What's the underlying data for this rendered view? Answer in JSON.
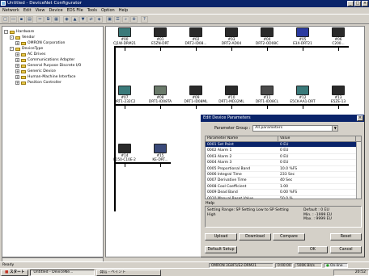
{
  "window": {
    "title": "Untitled - DeviceNet Configurator"
  },
  "menu": [
    "Network",
    "Edit",
    "View",
    "Device",
    "EDS File",
    "Tools",
    "Option",
    "Help"
  ],
  "toolbar_icons": [
    "new-icon",
    "open-icon",
    "save-icon",
    "print-icon",
    "cut-icon",
    "copy-icon",
    "paste-icon",
    "online-icon",
    "upload-icon",
    "download-icon",
    "compare-icon",
    "monitor-icon",
    "parameter-icon",
    "properties-icon",
    "find-icon",
    "zoom-icon",
    "help-icon"
  ],
  "tree": [
    {
      "label": "Hardware",
      "level": 0,
      "exp": "-"
    },
    {
      "label": "Vendor",
      "level": 1,
      "exp": "-"
    },
    {
      "label": "OMRON Corporation",
      "level": 2,
      "exp": "+"
    },
    {
      "label": "DeviceType",
      "level": 1,
      "exp": "-"
    },
    {
      "label": "AC Drives",
      "level": 2,
      "exp": "+"
    },
    {
      "label": "Communications Adapter",
      "level": 2,
      "exp": "+"
    },
    {
      "label": "General Purpose Discrete I/O",
      "level": 2,
      "exp": "+"
    },
    {
      "label": "Generic Device",
      "level": 2,
      "exp": "+"
    },
    {
      "label": "Human-Machine Interface",
      "level": 2,
      "exp": "+"
    },
    {
      "label": "Position Controller",
      "level": 2,
      "exp": "+"
    }
  ],
  "devices": {
    "row1": [
      {
        "addr": "#00",
        "name": "CJ1W-DRM21",
        "color": "#3a7a7a"
      },
      {
        "addr": "#01",
        "name": "E5ZN-DRT",
        "color": "#2a2a2a"
      },
      {
        "addr": "#02",
        "name": "DRT2-ID08...",
        "color": "#2a2a2a"
      },
      {
        "addr": "#03",
        "name": "DRT2-AD04",
        "color": "#2a2a2a"
      },
      {
        "addr": "#04",
        "name": "DRT2-OD08C",
        "color": "#2a2a2a"
      },
      {
        "addr": "#05",
        "name": "E3X-DRT21",
        "color": "#2a3aa0"
      },
      {
        "addr": "#06",
        "name": "C200...",
        "color": "#2a2a2a"
      }
    ],
    "row2": [
      {
        "addr": "#07",
        "name": "DRT1-232C2",
        "color": "#3a7a7a"
      },
      {
        "addr": "#08",
        "name": "DRT1-ID08TA",
        "color": "#6a7a6a"
      },
      {
        "addr": "#09",
        "name": "DRT1-ID08ML",
        "color": "#2a2a2a"
      },
      {
        "addr": "#10",
        "name": "DRT1-MD32ML",
        "color": "#2a2a2a"
      },
      {
        "addr": "#11",
        "name": "DRT1-ID08CL",
        "color": "#4a4a4a"
      },
      {
        "addr": "#12",
        "name": "E5CK-AA1-DRT",
        "color": "#3a7a7a"
      },
      {
        "addr": "#13",
        "name": "E5ZE-13",
        "color": "#2a2a2a"
      }
    ],
    "row3": [
      {
        "addr": "#14",
        "name": "F150-C10E-2",
        "color": "#2a2a2a"
      },
      {
        "addr": "#15",
        "name": "KE-DRT...",
        "color": "#3a4a7a"
      }
    ]
  },
  "dialog": {
    "title": "Edit Device Parameters",
    "param_group_label": "Parameter Group :",
    "param_group_value": "All parameters",
    "columns": [
      "Parameter Name",
      "Value"
    ],
    "rows": [
      {
        "name": "0001 Set Point",
        "value": "0 EU",
        "selected": true
      },
      {
        "name": "0002 Alarm 1",
        "value": "0 EU",
        "selected": false
      },
      {
        "name": "0003 Alarm 2",
        "value": "0 EU",
        "selected": false
      },
      {
        "name": "0004 Alarm 3",
        "value": "0 EU",
        "selected": false
      },
      {
        "name": "0005 Proportional Band",
        "value": "10.0 %FS",
        "selected": false
      },
      {
        "name": "0006 Integral Time",
        "value": "233 Sec",
        "selected": false
      },
      {
        "name": "0007 Derivative Time",
        "value": "40 Sec",
        "selected": false
      },
      {
        "name": "0008 Cool Coefficient",
        "value": "1.00",
        "selected": false
      },
      {
        "name": "0009 Dead Band",
        "value": "0.00 %FS",
        "selected": false
      },
      {
        "name": "0010 Manual Reset Value",
        "value": "50.0 %",
        "selected": false
      }
    ],
    "help_label": "Help",
    "help_text": "Setting Range: SP Setting Low to SP Setting High",
    "help_default": "Default : 0 EU",
    "help_min": "Min. : -1999 EU",
    "help_max": "Max. : 9999 EU",
    "buttons": {
      "upload": "Upload",
      "download": "Download",
      "compare": "Compare",
      "reset": "Reset",
      "default_setup": "Default Setup",
      "ok": "OK",
      "cancel": "Cancel"
    }
  },
  "status": {
    "left": "Ready",
    "device": "OMRON 3G8F5/E2-DRM21",
    "time": "0:00:00",
    "baud": "500K Bit/s",
    "online": "On-line"
  },
  "taskbar": {
    "start": "スタート",
    "tasks": [
      "Untitled - DeviceNe...",
      "発信 - ペイント"
    ],
    "clock": "20:52"
  }
}
